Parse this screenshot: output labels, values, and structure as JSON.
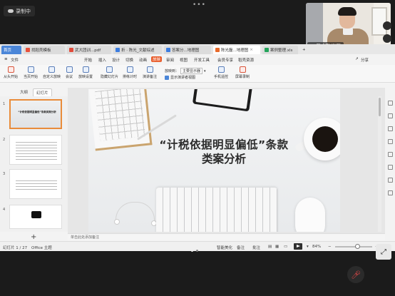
{
  "meeting": {
    "recording_label": "录制中",
    "more_label": "•••",
    "participant_name": "武大陈光磊"
  },
  "tabs": [
    {
      "label": "首页",
      "kind": "home"
    },
    {
      "label": "找稻壳模板",
      "kind": "normal"
    },
    {
      "label": "武大团训...pdf",
      "kind": "normal"
    },
    {
      "label": "折 · 陈光_文献综述",
      "kind": "normal"
    },
    {
      "label": "答案分...地理图",
      "kind": "normal"
    },
    {
      "label": "陈光磊...地理图",
      "kind": "active"
    },
    {
      "label": "案例整理.xls",
      "kind": "normal"
    }
  ],
  "menu": {
    "file_label": "文件",
    "items": [
      "开始",
      "插入",
      "设计",
      "切换",
      "动画",
      "放映",
      "审阅",
      "视图",
      "开发工具",
      "会员专享",
      "稻壳资源"
    ],
    "highlighted": "放映",
    "share_label": "分享"
  },
  "ribbon": {
    "buttons": [
      "从头开始",
      "当页开始",
      "自定义放映",
      "会议",
      "放映设置",
      "隐藏幻灯片",
      "排练计时",
      "演讲备注"
    ],
    "display_to_label": "放映到：",
    "display_to_value": "主要显示器",
    "show_presenter_view": "显示演讲者视图",
    "phone_remote": "手机遥控",
    "screen_record": "屏幕录制"
  },
  "panel_tabs": {
    "outline": "大纲",
    "slides": "幻灯片"
  },
  "thumbnails": [
    {
      "num": "1",
      "title": "“计税依据明显偏低”条款类案分析"
    },
    {
      "num": "2",
      "title": ""
    },
    {
      "num": "3",
      "title": ""
    },
    {
      "num": "4",
      "title": ""
    }
  ],
  "add_slide_icon": "+",
  "slide": {
    "title_line1": "“计税依据明显偏低”条款",
    "title_line2": "类案分析"
  },
  "notes_placeholder": "单击此处添加备注",
  "status": {
    "slide_counter": "幻灯片 1 / 27",
    "theme": "Office 主题",
    "smart_beautify": "智能美化",
    "notes": "备注",
    "annotate": "批注",
    "zoom": "84%"
  },
  "icons": {
    "mic_off": "mic-off-icon",
    "fullscreen": "fullscreen-icon"
  },
  "colors": {
    "home_tab": "#4b86d8",
    "highlight_menu": "#e85c2b",
    "selected_thumb": "#e98c3a"
  }
}
